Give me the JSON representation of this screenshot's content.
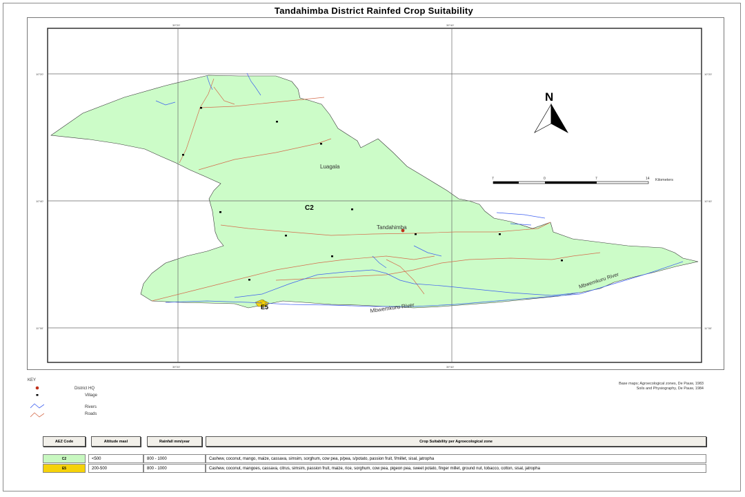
{
  "title": "Tandahimba District Rainfed Crop Suitability",
  "map": {
    "labels": {
      "luagala": "Luagala",
      "tandahimba": "Tandahimba",
      "zone_c2": "C2",
      "zone_e5": "E5",
      "river_south": "Mbwemkuru River",
      "river_east": "Mbwemkuru River"
    },
    "north_arrow": "N",
    "scale_bar": {
      "ticks": [
        "7",
        "0",
        "7",
        "14"
      ],
      "unit": "Kilometers"
    },
    "graticule": {
      "top": [
        "39°20'",
        "39°40'"
      ],
      "bottom": [
        "39°20'",
        "39°40'"
      ],
      "left": [
        "10°20'",
        "10°40'",
        "11°00'"
      ],
      "right": [
        "10°20'",
        "10°40'",
        "11°00'"
      ]
    },
    "colors": {
      "zone_fill": "#ccfcc8",
      "river": "#3c5ef0",
      "road": "#d46a4a",
      "district_hq": "#c0301a",
      "e5_marker": "#f5d20a"
    }
  },
  "key": {
    "heading": "KEY",
    "items": [
      {
        "label": "District HQ",
        "symbol": "red-dot"
      },
      {
        "label": "Village",
        "symbol": "black-dot"
      },
      {
        "label": "Rivers",
        "symbol": "blue-line"
      },
      {
        "label": "Roads",
        "symbol": "red-line"
      }
    ]
  },
  "credits": {
    "line1": "Base maps; Agroecological zones, De Pauw, 1983",
    "line2": "Soils and Physiography, De Pauw, 1984"
  },
  "aez_table": {
    "headers": [
      "AEZ Code",
      "Altitude masl",
      "Rainfall mm/year",
      "Crop Suitability per Agroecological zone"
    ],
    "rows": [
      {
        "code": "C2",
        "code_color": "#c8f8c0",
        "altitude": "<500",
        "rainfall": "800 - 1000",
        "crops": "Cashew, coconut, mango, maize, cassava, simsim, sorghum, cow pea, p/pea, s/potato, passion fruit, f/millet, sisal, jatropha"
      },
      {
        "code": "E5",
        "code_color": "#f5d20a",
        "altitude": "200-500",
        "rainfall": "800 - 1000",
        "crops": "Cashew, coconut, mangoes, cassava, citrus, simsim, passion fruit, maize, rice, sorghum, cow pea, pigeon pea, sweet potato, finger millet, ground nut, tobacco, cotton,  sisal, jatropha"
      }
    ]
  }
}
